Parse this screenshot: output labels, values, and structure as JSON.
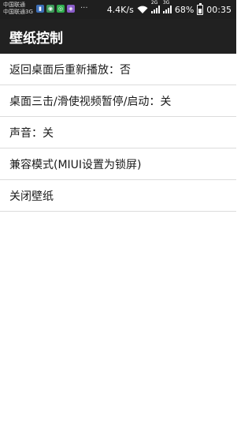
{
  "status_bar": {
    "carrier_1": "中国联通",
    "carrier_2": "中国联通3G",
    "overflow": "···",
    "speed": "4.4K/s",
    "signal_1_tag": "2G",
    "signal_2_tag": "3G",
    "battery": "68%",
    "battery_level": 0.68,
    "time": "00:35",
    "notif_icons": [
      {
        "name": "app-icon-blue",
        "color": "#3d6fb8"
      },
      {
        "name": "chat-icon",
        "color": "#3e9a5a"
      },
      {
        "name": "wechat-icon",
        "color": "#2fae4e"
      },
      {
        "name": "app-icon-purple",
        "color": "#8a5cc9"
      }
    ]
  },
  "app_bar": {
    "title": "壁纸控制"
  },
  "list": {
    "items": [
      {
        "label": "返回桌面后重新播放：否"
      },
      {
        "label": "桌面三击/滑使视频暂停/启动：关"
      },
      {
        "label": "声音：关"
      },
      {
        "label": "兼容模式(MIUI设置为锁屏)"
      },
      {
        "label": "关闭壁纸"
      }
    ]
  },
  "colors": {
    "app_bar_bg": "#212121",
    "status_bar_bg": "#1f1f1f",
    "divider": "#dcdcdc"
  }
}
